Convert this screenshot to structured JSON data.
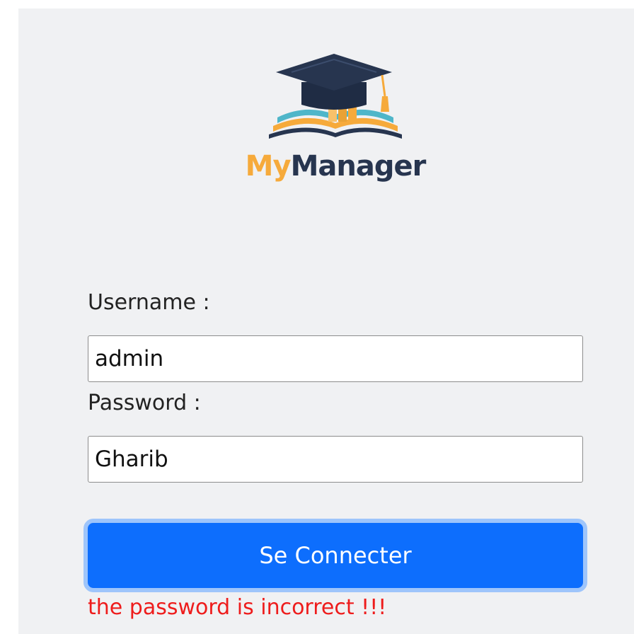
{
  "brand": {
    "prefix": "My",
    "suffix": "Manager",
    "logo_icon": "graduation-cap-book-icon",
    "colors": {
      "orange": "#f6aa3b",
      "navy": "#27354f",
      "teal": "#4fb6c9"
    }
  },
  "form": {
    "username_label": "Username :",
    "username_value": "admin",
    "password_label": "Password :",
    "password_value": "Gharib",
    "submit_label": "Se Connecter",
    "error_message": "the password is incorrect !!!"
  },
  "colors": {
    "button_bg": "#0d6efd",
    "button_focus_ring": "#9ec5fb",
    "error": "#ee1c1c"
  }
}
